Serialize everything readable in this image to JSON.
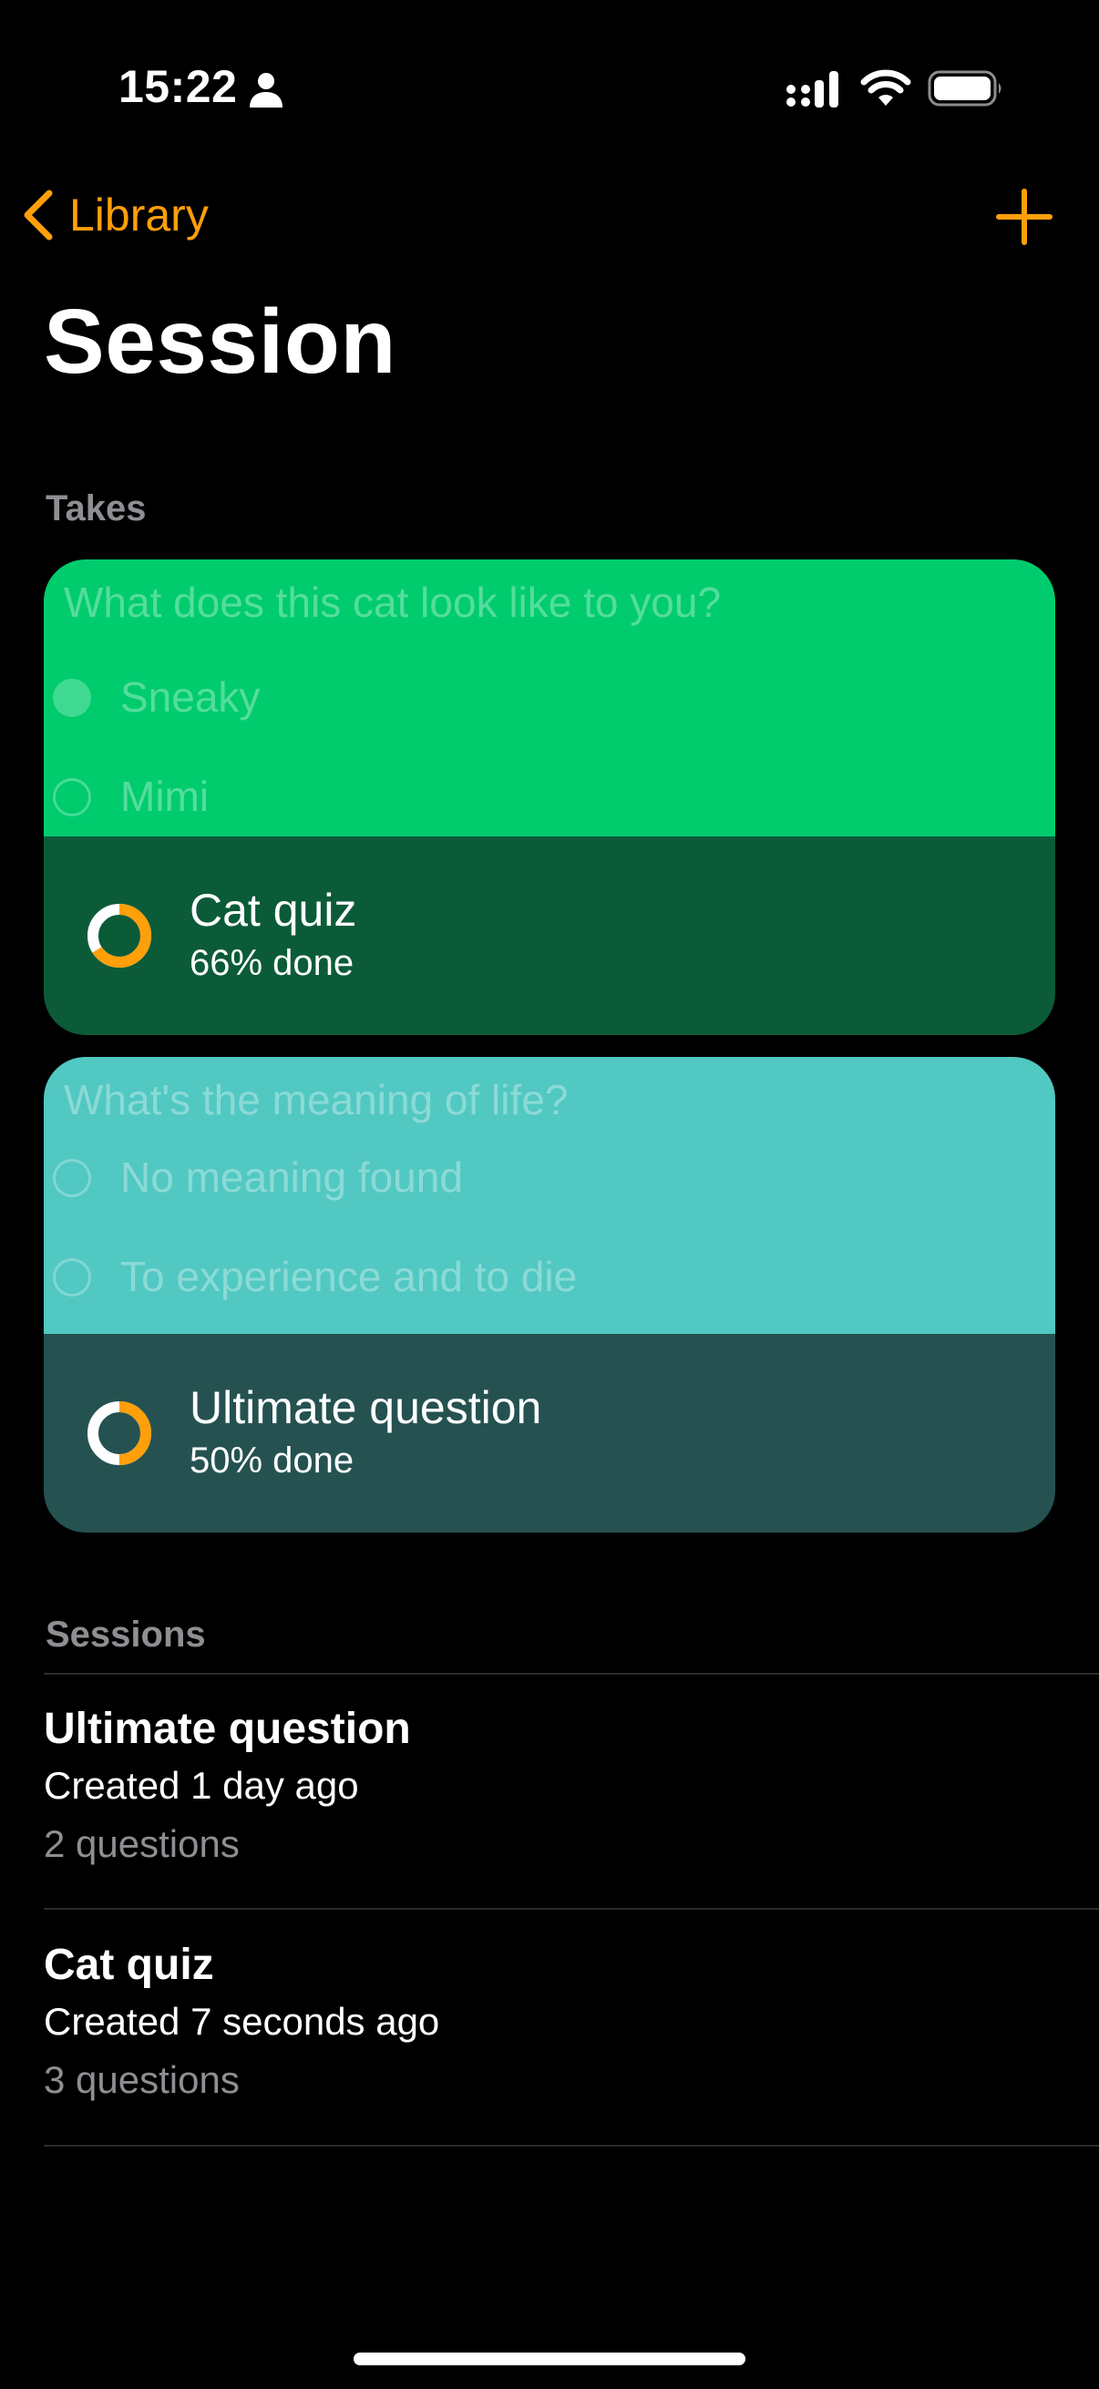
{
  "status_bar": {
    "time": "15:22"
  },
  "nav": {
    "back_label": "Library"
  },
  "page": {
    "title": "Session"
  },
  "takes": {
    "header": "Takes",
    "cards": [
      {
        "question": "What does this cat look like to you?",
        "options": [
          "Sneaky",
          "Mimi"
        ],
        "title": "Cat quiz",
        "progress_text": "66% done",
        "progress": 0.66,
        "top_color": "#00cc6e",
        "bottom_color": "#0b5b38"
      },
      {
        "question": "What's the meaning of life?",
        "options": [
          "No meaning found",
          "To experience and to die"
        ],
        "title": "Ultimate question",
        "progress_text": "50% done",
        "progress": 0.5,
        "top_color": "#52c8c2",
        "bottom_color": "#255251"
      }
    ]
  },
  "sessions": {
    "header": "Sessions",
    "items": [
      {
        "name": "Ultimate question",
        "created": "Created 1 day ago",
        "count": "2 questions"
      },
      {
        "name": "Cat quiz",
        "created": "Created 7 seconds ago",
        "count": "3 questions"
      }
    ]
  },
  "colors": {
    "accent": "#ff9f0a",
    "background": "#000000",
    "secondary_text": "#8e8e93"
  }
}
